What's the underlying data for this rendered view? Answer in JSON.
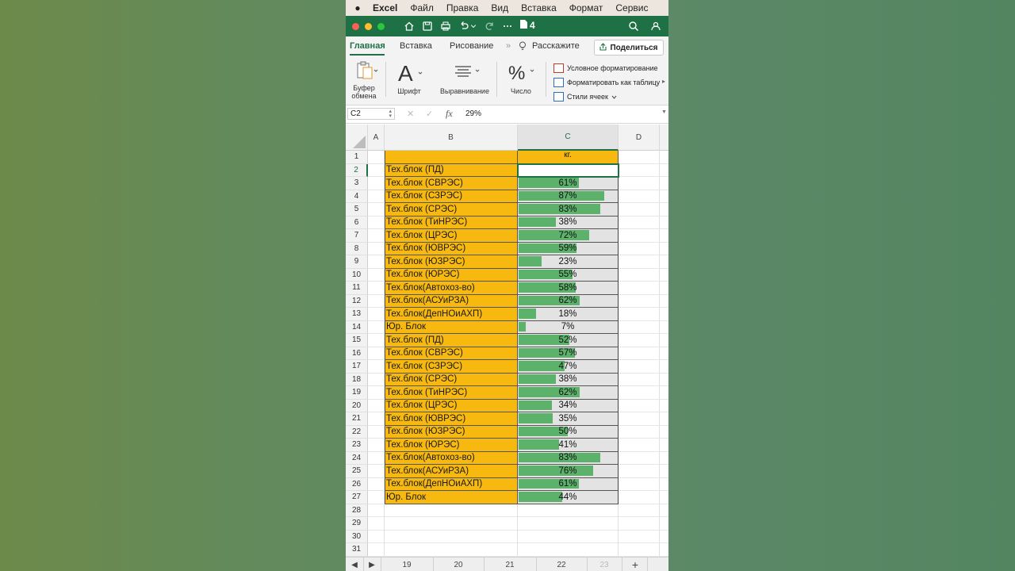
{
  "menubar": {
    "app_name": "Excel",
    "items": [
      "Файл",
      "Правка",
      "Вид",
      "Вставка",
      "Формат",
      "Сервис"
    ]
  },
  "titlebar": {
    "doc_title": "4"
  },
  "ribbon": {
    "tabs": [
      "Главная",
      "Вставка",
      "Рисование",
      "Расскажите"
    ],
    "share_label": "Поделиться",
    "groups": {
      "clipboard": "Буфер обмена",
      "font": "Шрифт",
      "alignment": "Выравнивание",
      "number": "Число"
    },
    "styles": [
      "Условное форматирование",
      "Форматировать как таблицу",
      "Стили ячеек"
    ]
  },
  "formula_bar": {
    "name_box": "C2",
    "fx": "fx",
    "value": "29%"
  },
  "columns": [
    "A",
    "B",
    "C",
    "D"
  ],
  "header_row": {
    "row": "1",
    "c": "кг."
  },
  "rows": [
    {
      "n": "2",
      "b": "Тех.блок (ПД)",
      "c": "29%",
      "p": 0.29
    },
    {
      "n": "3",
      "b": "Тех.блок (СВРЭС)",
      "c": "61%",
      "p": 0.61
    },
    {
      "n": "4",
      "b": "Тех.блок (СЗРЭС)",
      "c": "87%",
      "p": 0.87
    },
    {
      "n": "5",
      "b": "Тех.блок (СРЭС)",
      "c": "83%",
      "p": 0.83
    },
    {
      "n": "6",
      "b": "Тех.блок (ТиНРЭС)",
      "c": "38%",
      "p": 0.38
    },
    {
      "n": "7",
      "b": "Тех.блок (ЦРЭС)",
      "c": "72%",
      "p": 0.72
    },
    {
      "n": "8",
      "b": "Тех.блок (ЮВРЭС)",
      "c": "59%",
      "p": 0.59
    },
    {
      "n": "9",
      "b": "Тех.блок (ЮЗРЭС)",
      "c": "23%",
      "p": 0.23
    },
    {
      "n": "10",
      "b": "Тех.блок (ЮРЭС)",
      "c": "55%",
      "p": 0.55
    },
    {
      "n": "11",
      "b": "Тех.блок(Автохоз-во)",
      "c": "58%",
      "p": 0.58
    },
    {
      "n": "12",
      "b": "Тех.блок(АСУиРЗА)",
      "c": "62%",
      "p": 0.62
    },
    {
      "n": "13",
      "b": "Тех.блок(ДепНОиАХП)",
      "c": "18%",
      "p": 0.18
    },
    {
      "n": "14",
      "b": "Юр. Блок",
      "c": "7%",
      "p": 0.07
    },
    {
      "n": "15",
      "b": "Тех.блок (ПД)",
      "c": "52%",
      "p": 0.52
    },
    {
      "n": "16",
      "b": "Тех.блок (СВРЭС)",
      "c": "57%",
      "p": 0.57
    },
    {
      "n": "17",
      "b": "Тех.блок (СЗРЭС)",
      "c": "47%",
      "p": 0.47
    },
    {
      "n": "18",
      "b": "Тех.блок (СРЭС)",
      "c": "38%",
      "p": 0.38
    },
    {
      "n": "19",
      "b": "Тех.блок (ТиНРЭС)",
      "c": "62%",
      "p": 0.62
    },
    {
      "n": "20",
      "b": "Тех.блок (ЦРЭС)",
      "c": "34%",
      "p": 0.34
    },
    {
      "n": "21",
      "b": "Тех.блок (ЮВРЭС)",
      "c": "35%",
      "p": 0.35
    },
    {
      "n": "22",
      "b": "Тех.блок (ЮЗРЭС)",
      "c": "50%",
      "p": 0.5
    },
    {
      "n": "23",
      "b": "Тех.блок (ЮРЭС)",
      "c": "41%",
      "p": 0.41
    },
    {
      "n": "24",
      "b": "Тех.блок(Автохоз-во)",
      "c": "83%",
      "p": 0.83
    },
    {
      "n": "25",
      "b": "Тех.блок(АСУиРЗА)",
      "c": "76%",
      "p": 0.76
    },
    {
      "n": "26",
      "b": "Тех.блок(ДепНОиАХП)",
      "c": "61%",
      "p": 0.61
    },
    {
      "n": "27",
      "b": "Юр. Блок",
      "c": "44%",
      "p": 0.44
    }
  ],
  "empty_rows": [
    "28",
    "29",
    "30",
    "31"
  ],
  "sheet_tabs": [
    "19",
    "20",
    "21",
    "22",
    "23"
  ],
  "add_sheet": "+",
  "colors": {
    "accent": "#1e7145",
    "cell_fill": "#f7b90f",
    "bar": "#5cb16b",
    "bar_first": "#6cc67a"
  }
}
